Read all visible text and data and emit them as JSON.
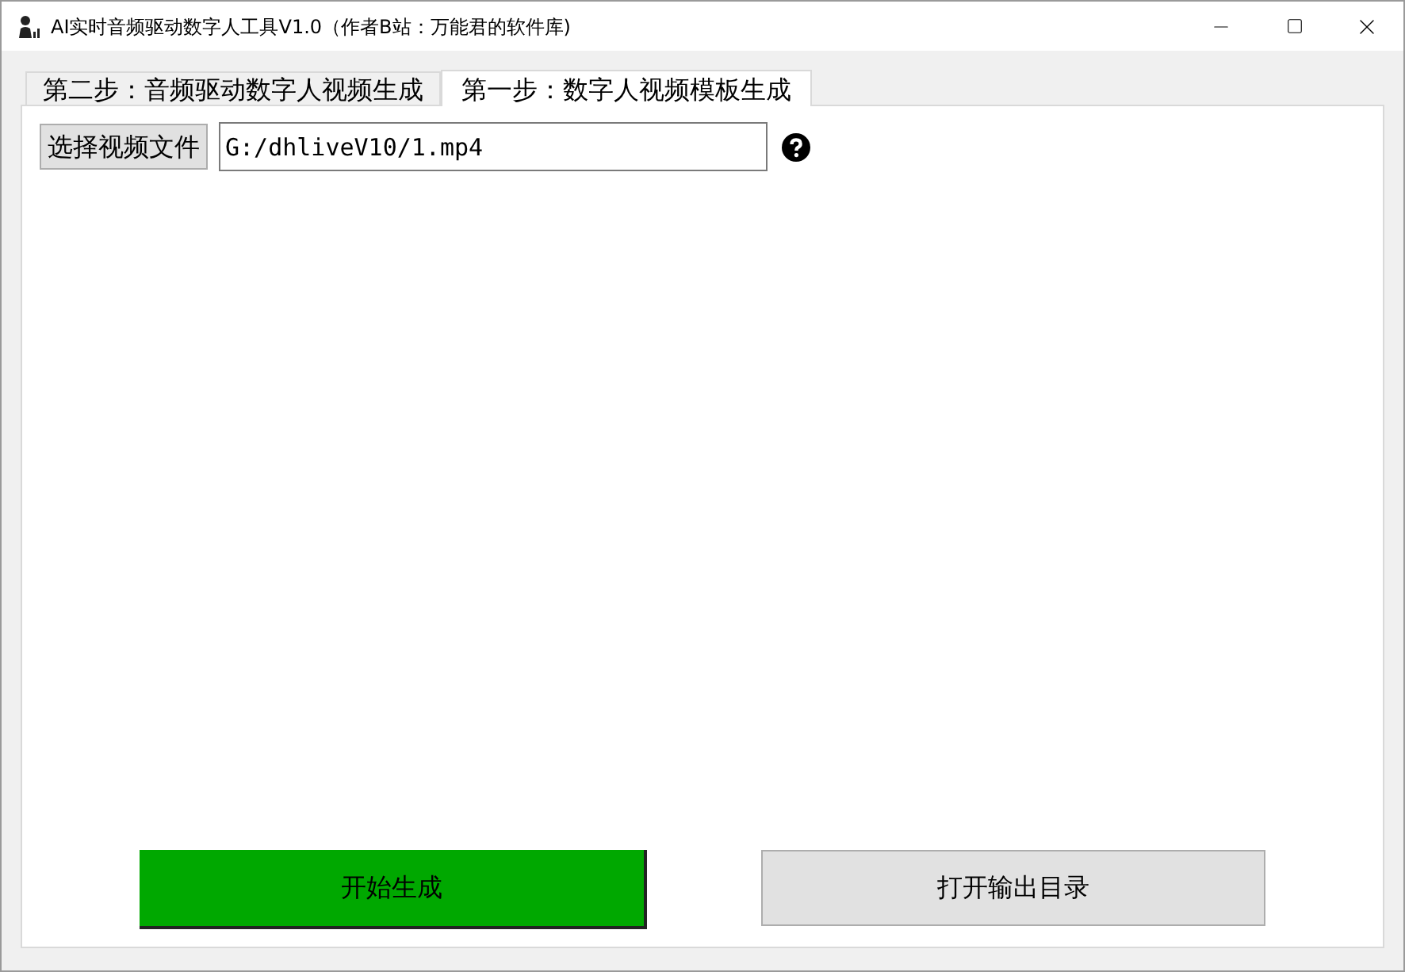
{
  "window": {
    "title": "AI实时音频驱动数字人工具V1.0（作者B站：万能君的软件库)"
  },
  "tabs": [
    {
      "label": "第二步：音频驱动数字人视频生成",
      "selected": false
    },
    {
      "label": "第一步：数字人视频模板生成",
      "selected": true
    }
  ],
  "file_row": {
    "button": "选择视频文件",
    "value": "G:/dhliveV10/1.mp4"
  },
  "actions": [
    {
      "label": "开始生成",
      "kind": "primary"
    },
    {
      "label": "打开输出目录",
      "kind": "secondary"
    }
  ]
}
